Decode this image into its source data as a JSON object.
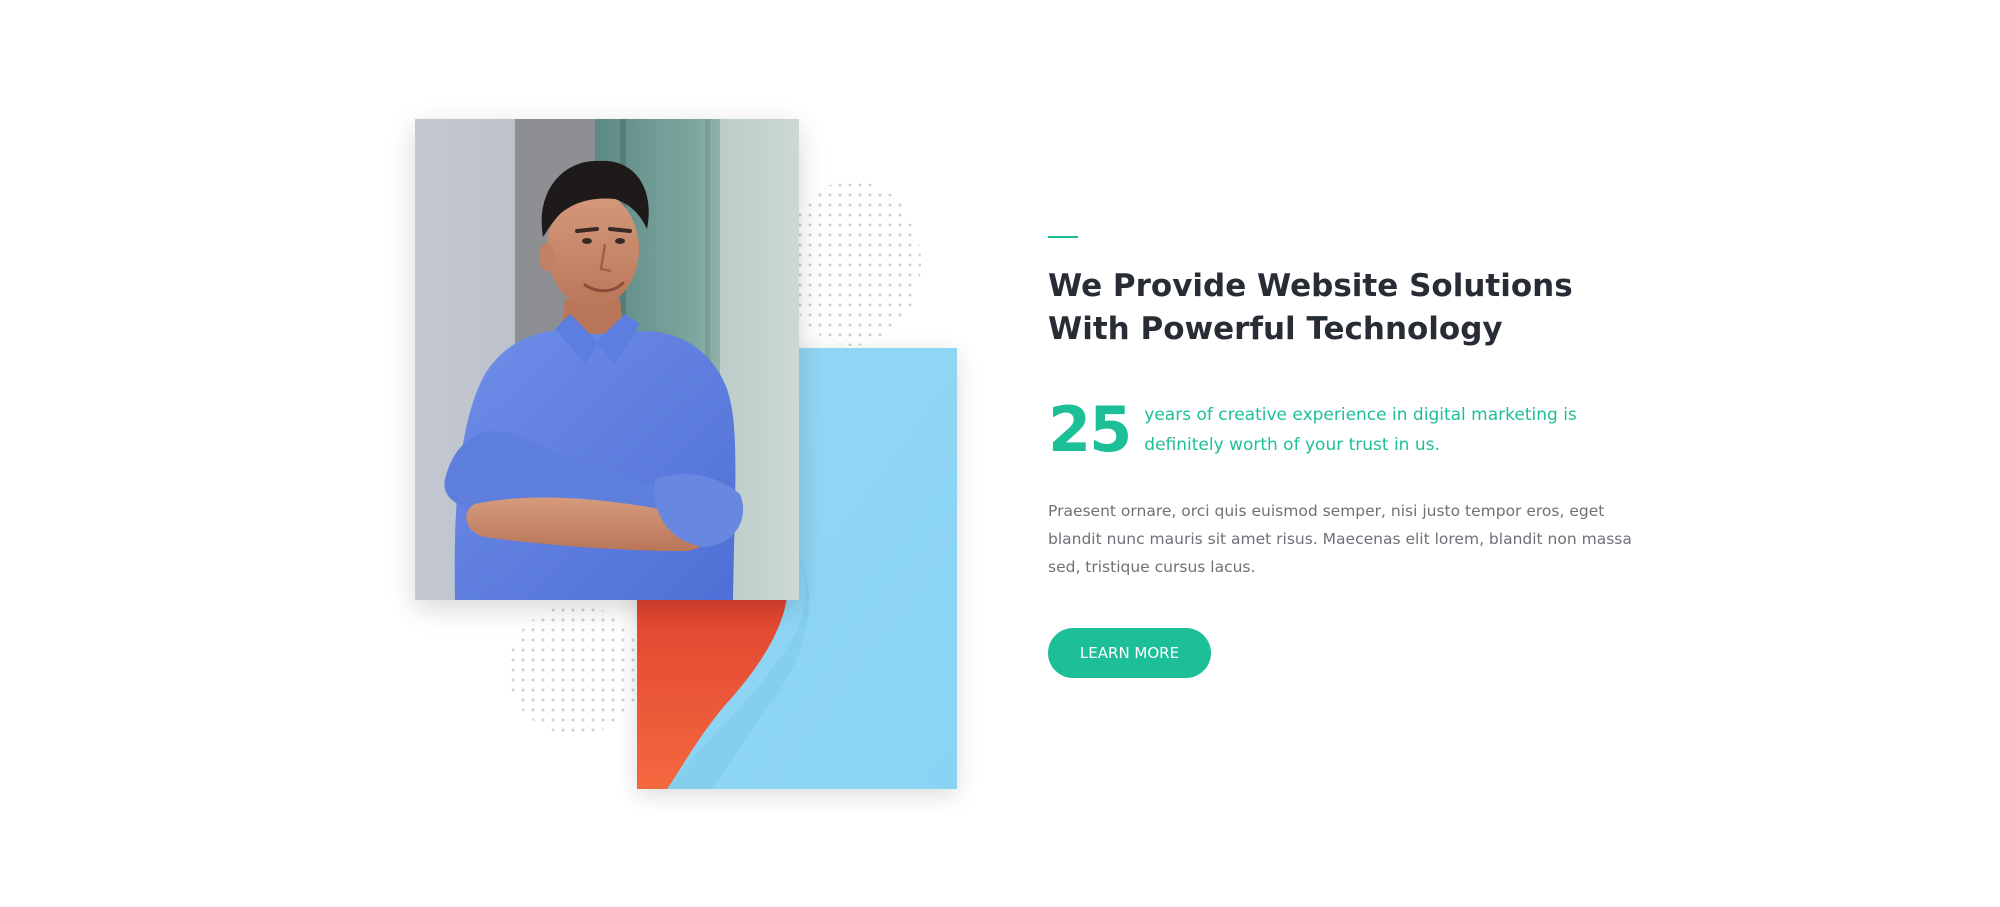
{
  "section": {
    "heading_line1": "We Provide Website Solutions",
    "heading_line2": "With Powerful Technology",
    "stat": {
      "number": "25",
      "text_line1": "years of creative experience in digital marketing is",
      "text_line2": "definitely worth of your trust in us."
    },
    "body_line1": "Praesent ornare, orci quis euismod semper, nisi justo tempor eros, eget",
    "body_line2": "blandit nunc mauris sit amet risus. Maecenas elit lorem, blandit non massa",
    "body_line3": "sed, tristique cursus lacus.",
    "button_label": "LEARN MORE"
  },
  "colors": {
    "accent": "#1dbf98",
    "heading": "#282c35",
    "body": "#6f7178",
    "background": "#ffffff"
  },
  "images": {
    "portrait": "man-in-blue-shirt-arms-crossed-photo",
    "artwork": "colorful-paper-curl-artwork"
  }
}
